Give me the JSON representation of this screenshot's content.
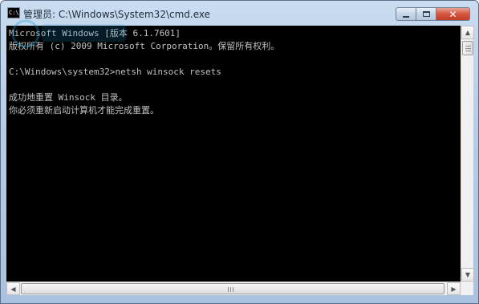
{
  "window": {
    "title": "管理员: C:\\Windows\\System32\\cmd.exe",
    "icon_text": "C:\\",
    "controls": {
      "minimize": "",
      "maximize": "",
      "close": "✕"
    }
  },
  "console": {
    "lines": [
      "Microsoft Windows [版本 6.1.7601]",
      "版权所有 (c) 2009 Microsoft Corporation。保留所有权利。",
      "",
      "C:\\Windows\\system32>netsh winsock resets",
      "",
      "成功地重置 Winsock 目录。",
      "你必须重新启动计算机才能完成重置。"
    ]
  },
  "scrollbars": {
    "up_arrow": "▲",
    "down_arrow": "▼",
    "left_arrow": "◀",
    "right_arrow": "▶"
  },
  "colors": {
    "console_background": "#000000",
    "console_text": "#c0c0c0",
    "title_bar": "#b7cde6",
    "close_button": "#c23e28"
  }
}
